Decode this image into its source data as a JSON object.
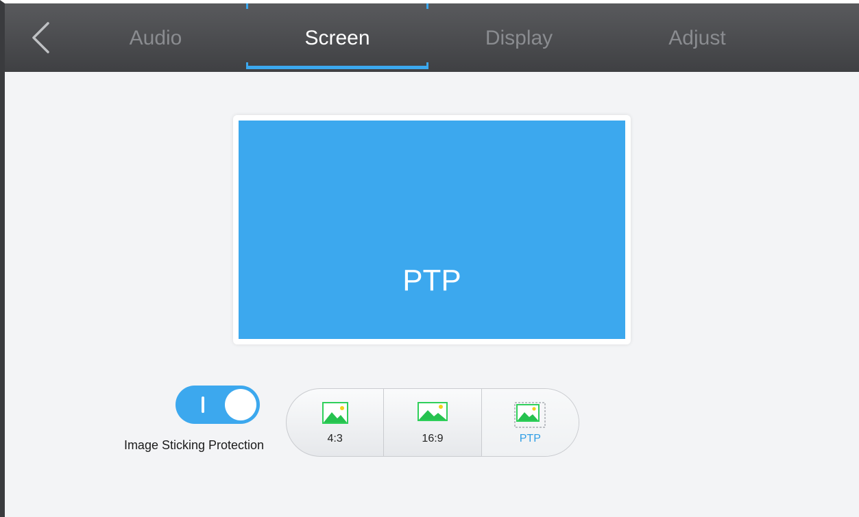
{
  "tabs": [
    {
      "label": "Audio",
      "active": false
    },
    {
      "label": "Screen",
      "active": true
    },
    {
      "label": "Display",
      "active": false
    },
    {
      "label": "Adjust",
      "active": false
    }
  ],
  "preview": {
    "label": "PTP"
  },
  "toggle": {
    "label": "Image Sticking Protection",
    "on": true
  },
  "aspect_options": [
    {
      "label": "4:3",
      "icon": "image-icon",
      "selected": false
    },
    {
      "label": "16:9",
      "icon": "image-icon",
      "selected": false
    },
    {
      "label": "PTP",
      "icon": "image-fit-icon",
      "selected": true
    }
  ],
  "colors": {
    "accent": "#3ca8ee",
    "topbar": "#4a4b4e",
    "background": "#f3f4f6"
  }
}
